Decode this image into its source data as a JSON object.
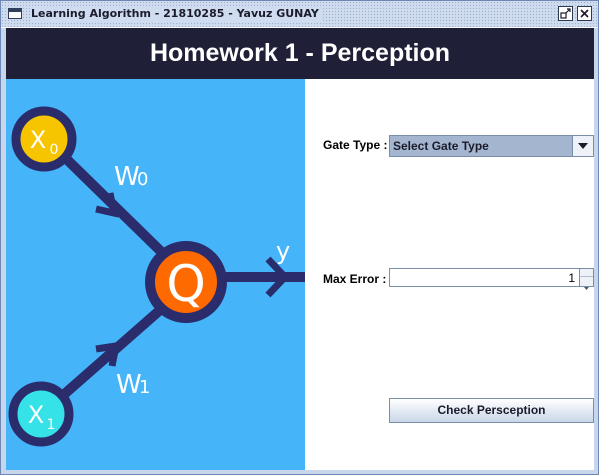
{
  "window": {
    "title": "Learning Algorithm - 21810285 - Yavuz GUNAY"
  },
  "header": {
    "title": "Homework 1 - Perception"
  },
  "diagram": {
    "input0_label": "X",
    "input0_sub": "0",
    "input1_label": "X",
    "input1_sub": "1",
    "weight0_label": "W",
    "weight0_sub": "0",
    "weight1_label": "W",
    "weight1_sub": "1",
    "node_label": "Q",
    "output_label": "y",
    "colors": {
      "background": "#45b4f8",
      "edge": "#2b2c6c",
      "input0_fill": "#f6c500",
      "input1_fill": "#34e2e8",
      "node_fill": "#ff6a00"
    }
  },
  "form": {
    "gate_type_label": "Gate Type :",
    "gate_type_selected": "Select Gate Type",
    "max_error_label": "Max Error :",
    "max_error_value": "1",
    "check_button_label": "Check Persception"
  }
}
